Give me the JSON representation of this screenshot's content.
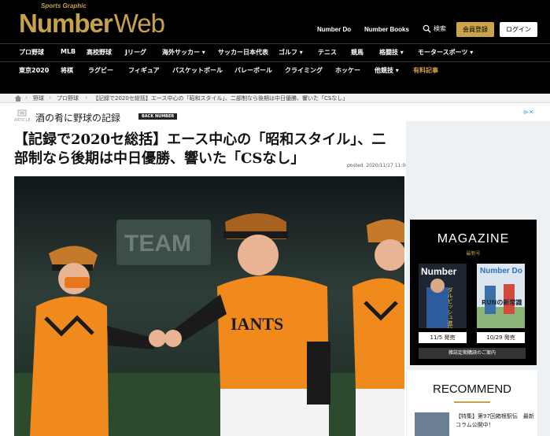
{
  "header": {
    "logo_small": "Sports Graphic",
    "logo_main": "Number",
    "logo_web": "Web",
    "link_do": "Number Do",
    "link_books": "Number Books",
    "search_label": "検索",
    "member_button": "会員登録",
    "login_button": "ログイン"
  },
  "nav": {
    "row1": [
      "プロ野球",
      "MLB",
      "高校野球",
      "Jリーグ",
      "海外サッカー ▾",
      "サッカー日本代表",
      "ゴルフ ▾",
      "テニス",
      "競馬",
      "格闘技 ▾",
      "モータースポーツ ▾"
    ],
    "row2": [
      "東京2020",
      "将棋",
      "ラグビー",
      "フィギュア",
      "バスケットボール",
      "バレーボール",
      "クライミング",
      "ホッケー",
      "他競技 ▾",
      "有料記事"
    ]
  },
  "breadcrumb": [
    "野球",
    "プロ野球",
    "【記録で2020セ総括】エース中心の「昭和スタイル」、二部制なら後期は中日優勝、響いた「CSなし」"
  ],
  "article": {
    "icon_label": "ARTICLE",
    "series": "酒の肴に野球の記録",
    "back_number": "BACK NUMBER",
    "headline_line1": "【記録で2020セ総括】エース中心の「昭和スタイル」、二",
    "headline_line2": "部制なら後期は中日優勝、響いた「CSなし」",
    "posted_label": "posted",
    "posted_date": "2020/11/17 11:00",
    "photo_banner": "TEAM",
    "jersey_text": "IANTS"
  },
  "sidebar": {
    "ad_mark": "⊳✕",
    "magazine_title": "MAGAZINE",
    "magazine_sub": "最新号",
    "cover1_title": "Number",
    "cover1_text": "ダルビッシュ進化論",
    "cover1_button": "11/5 発売",
    "cover2_title": "Number Do",
    "cover2_text": "RUNの新常識",
    "cover2_button": "10/29 発売",
    "subscribe_button": "雑誌定期購読のご案内",
    "recommend_title": "RECOMMEND",
    "recommend_item": "【特集】第97回箱根駅伝　最新コラム公開中！"
  },
  "colors": {
    "gold": "#c8a24a",
    "black": "#000000",
    "jersey_orange": "#f08a1c"
  }
}
